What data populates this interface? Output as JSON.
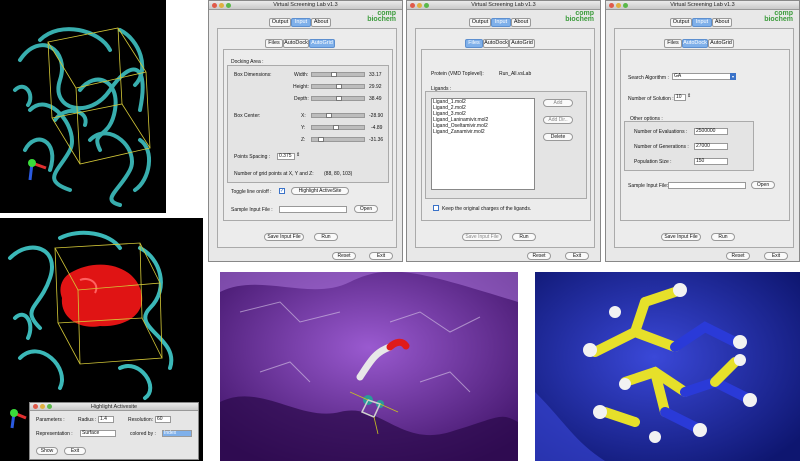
{
  "colors": {
    "ribbon": "#3bb8b8",
    "surface_red": "#e01414",
    "box_line": "#d4c838",
    "tab_selected": "#7fb0ea",
    "logo_green": "#3c9c3c",
    "purple_surface": "#6a2a9a",
    "blue_surface": "#2633b8",
    "yellow_carbon": "#e6e02a"
  },
  "window_common": {
    "title": "Virtual Screening Lab v1.3",
    "logo_line1": "comp",
    "logo_line2": "biochem",
    "tab_output": "Output",
    "tab_input": "Input",
    "tab_about": "About",
    "tab_files": "Files",
    "tab_autodock": "AutoDock",
    "tab_autogrid": "AutoGrid",
    "save_input_file": "Save Input File",
    "run": "Run",
    "reset": "Reset",
    "exit": "Exit"
  },
  "autogrid": {
    "docking_area": "Docking Area :",
    "box_dimensions": "Box Dimensions:",
    "width_label": "Width:",
    "width_value": "33.17",
    "height_label": "Height:",
    "height_value": "29.92",
    "depth_label": "Depth:",
    "depth_value": "38.49",
    "box_center": "Box Center:",
    "x_label": "X:",
    "x_value": "-28.90",
    "y_label": "Y:",
    "y_value": "-4.89",
    "z_label": "Z:",
    "z_value": "-31.36",
    "points_spacing_label": "Points Spacing :",
    "points_spacing_value": "0.375",
    "grid_points_label": "Number of grid points at X, Y and Z:",
    "grid_points_value": "(88, 80, 103)",
    "toggle_label": "Toggle line on/off :",
    "highlight_activesite": "Highlight ActiveSite",
    "sample_input_label": "Sample Input File :",
    "open": "Open"
  },
  "files": {
    "protein_label": "Protein (VMD Toplevel):",
    "protein_value": "Run_All.vsLab",
    "ligands_label": "Ligands :",
    "ligands": [
      "Ligand_1.mol2",
      "Ligand_2.mol2",
      "Ligand_3.mol2",
      "Ligand_Laninamivir.mol2",
      "Ligand_Oseltamivir.mol2",
      "Ligand_Zanamivir.mol2"
    ],
    "add": "Add",
    "add_dir": "Add Dir..",
    "delete": "Delete",
    "keep_charges": "Keep the original charges of the ligands."
  },
  "autodock": {
    "search_algorithm_label": "Search Algorithm :",
    "search_algorithm_value": "GA",
    "num_solution_label": "Number of Solution :",
    "num_solution_value": "10",
    "other_options": "Other options :",
    "evaluations_label": "Number of Evaluations :",
    "evaluations_value": "2500000",
    "generations_label": "Number of Generations :",
    "generations_value": "27000",
    "population_label": "Population Size :",
    "population_value": "150",
    "sample_input_label": "Sample Input File:",
    "open": "Open"
  },
  "highlight_dialog": {
    "title": "Highlight Activesite",
    "parameters_label": "Parameters :",
    "radius_label": "Radius :",
    "radius_value": "1.4",
    "resolution_label": "Resolution:",
    "resolution_value": "60",
    "representation_label": "Representation :",
    "representation_value": "Surface",
    "colored_by_label": "colored by :",
    "colored_by_value": "Index",
    "show": "Show",
    "exit": "Exit"
  },
  "axes": {
    "x_label": "x",
    "y_label": "y",
    "z_label": "z"
  }
}
